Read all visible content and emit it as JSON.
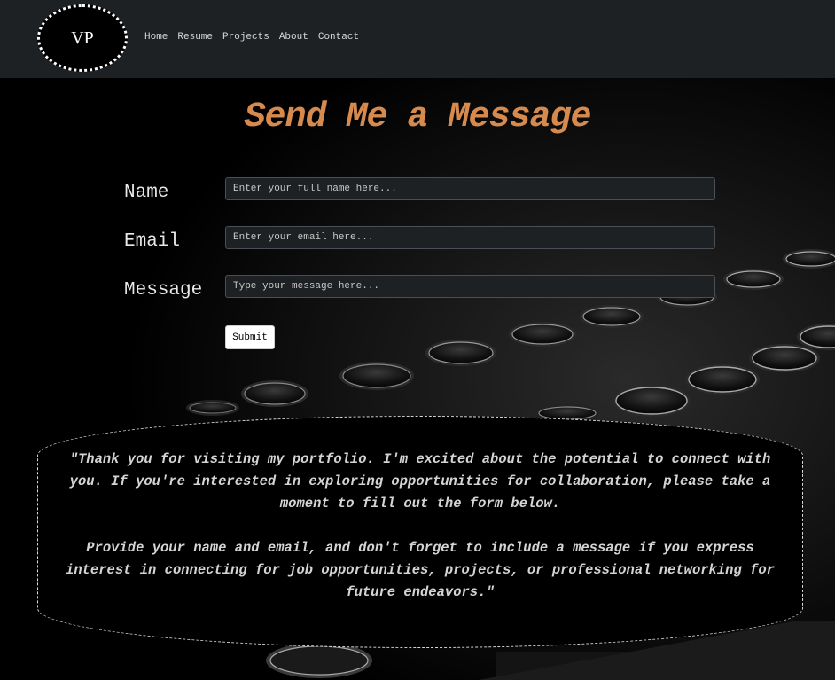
{
  "header": {
    "logo_text": "VP",
    "nav": [
      "Home",
      "Resume",
      "Projects",
      "About",
      "Contact"
    ]
  },
  "main": {
    "title": "Send Me a Message",
    "form": {
      "name_label": "Name",
      "name_placeholder": "Enter your full name here...",
      "email_label": "Email",
      "email_placeholder": "Enter your email here...",
      "message_label": "Message",
      "message_placeholder": "Type your message here...",
      "submit_label": "Submit"
    },
    "quote": {
      "paragraph1": "\"Thank you for visiting my portfolio. I'm excited about the potential to connect with you. If you're interested in exploring opportunities for collaboration, please take a moment to fill out the form below.",
      "paragraph2": "Provide your name and email, and don't forget to include a message if you express interest in connecting for job opportunities, projects, or professional networking for future endeavors.\""
    }
  },
  "colors": {
    "header_bg": "#1e2124",
    "title_accent": "#d68a4e",
    "input_bg": "#1e2124",
    "page_bg": "#000000"
  }
}
